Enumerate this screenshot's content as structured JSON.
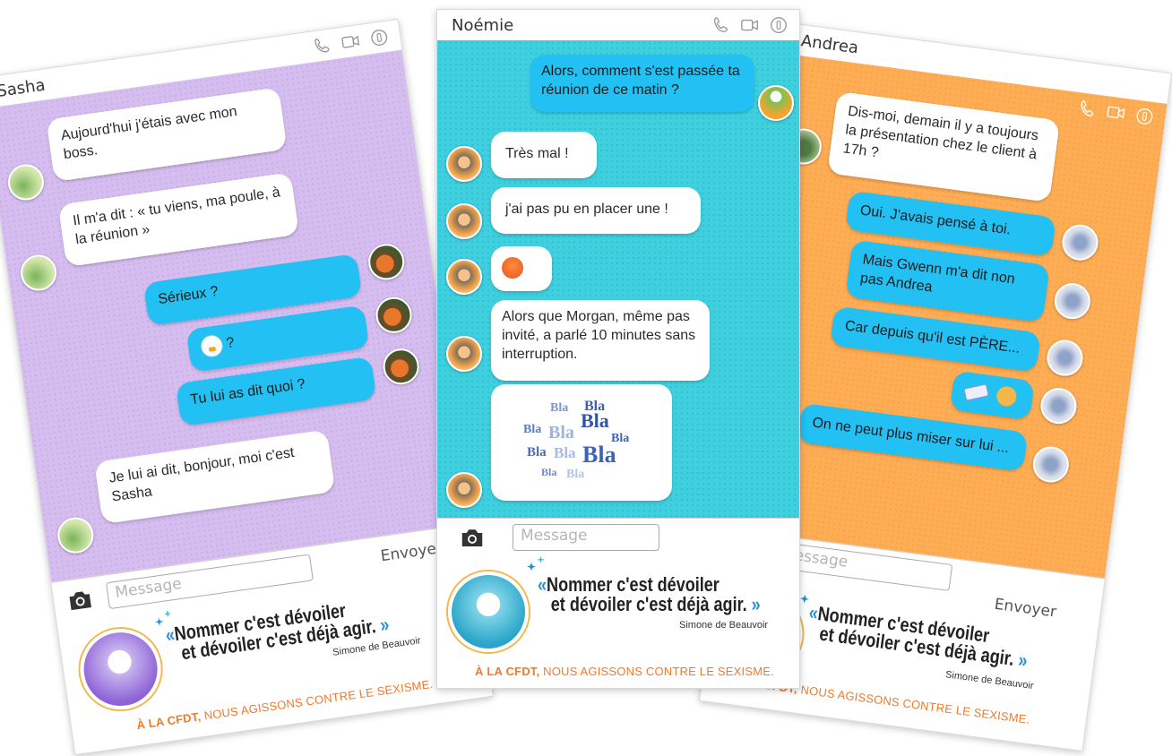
{
  "cards": {
    "sasha": {
      "contact": "Sasha",
      "messages": [
        "Aujourd'hui j'étais avec mon boss.",
        "Il m'a dit : « tu viens, ma poule, à la réunion »",
        "Sérieux ?",
        "?",
        "Tu lui as dit quoi ?",
        "Je lui ai dit, bonjour, moi c'est Sasha"
      ],
      "input_placeholder": "Message",
      "send_label": "Envoyer",
      "quote_line1": "Nommer c'est dévoiler",
      "quote_line2": "et dévoiler c'est déjà agir.",
      "author": "Simone de Beauvoir",
      "slogan_bold": "À LA CFDT,",
      "slogan_rest": " NOUS AGISSONS CONTRE LE SEXISME."
    },
    "noemie": {
      "contact": "Noémie",
      "messages": [
        "Alors, comment s'est passée ta réunion de ce matin ?",
        "Très mal !",
        "j'ai pas pu en placer une !",
        "Alors que Morgan, même pas invité, a parlé 10 minutes sans interruption."
      ],
      "word_cloud": "Bla",
      "input_placeholder": "Message",
      "quote_line1": "Nommer c'est dévoiler",
      "quote_line2": "et dévoiler c'est déjà agir.",
      "author": "Simone de Beauvoir",
      "slogan_bold": "À LA CFDT,",
      "slogan_rest": " NOUS AGISSONS CONTRE LE SEXISME."
    },
    "andrea": {
      "contact": "Andrea",
      "messages": [
        "Dis-moi, demain il y a toujours la présentation chez le client à 17h ?",
        "Oui. J'avais pensé à toi.",
        "Mais Gwenn m'a dit non pas Andrea",
        "Car depuis qu'il est PÈRE...",
        "On ne peut plus miser sur lui ..."
      ],
      "input_placeholder": "Message",
      "send_label": "Envoyer",
      "quote_line1": "Nommer c'est dévoiler",
      "quote_line2": "et dévoiler c'est déjà agir.",
      "author": "Simone de Beauvoir",
      "slogan_bold": "À LA CFDT,",
      "slogan_rest": " NOUS AGISSONS CONTRE LE SEXISME."
    }
  },
  "colors": {
    "sasha_bg": "#d6bdf0",
    "noemie_bg": "#3fd0df",
    "andrea_bg": "#ffad55",
    "bubble_out": "#22c0f3",
    "accent_orange": "#f07a2b",
    "quote_blue": "#2a90d8"
  },
  "icons": [
    "phone-icon",
    "video-icon",
    "info-icon",
    "camera-icon",
    "emoji-icon"
  ]
}
